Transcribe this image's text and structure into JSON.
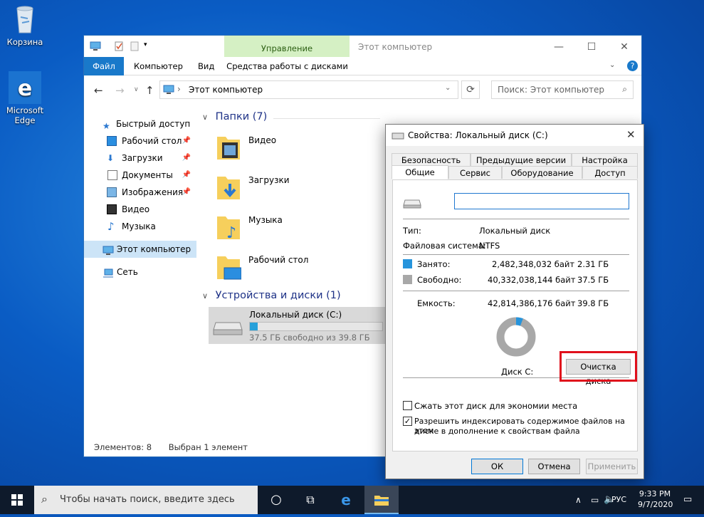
{
  "desktop": {
    "recycle_bin": "Корзина",
    "edge_line1": "Microsoft",
    "edge_line2": "Edge"
  },
  "explorer": {
    "context_tab": "Управление",
    "window_title": "Этот компьютер",
    "tabs": [
      "Файл",
      "Компьютер",
      "Вид",
      "Средства работы с дисками"
    ],
    "address": "Этот компьютер",
    "search_placeholder": "Поиск: Этот компьютер",
    "nav": {
      "quick_access": "Быстрый доступ",
      "desktop": "Рабочий стол",
      "downloads": "Загрузки",
      "documents": "Документы",
      "pictures": "Изображения",
      "videos": "Видео",
      "music": "Музыка",
      "this_pc": "Этот компьютер",
      "network": "Сеть"
    },
    "folders_header": "Папки (7)",
    "folders": [
      "Видео",
      "Загрузки",
      "Музыка",
      "Рабочий стол"
    ],
    "devices_header": "Устройства и диски (1)",
    "drive": {
      "name": "Локальный диск (C:)",
      "free_text": "37.5 ГБ свободно из 39.8 ГБ",
      "used_fraction": 0.058
    },
    "status": {
      "items": "Элементов: 8",
      "selected": "Выбран 1 элемент"
    }
  },
  "dialog": {
    "title": "Свойства: Локальный диск (C:)",
    "tabs_row1": [
      "Безопасность",
      "Предыдущие версии",
      "Настройка"
    ],
    "tabs_row2": [
      "Общие",
      "Сервис",
      "Оборудование",
      "Доступ"
    ],
    "type_label": "Тип:",
    "type_value": "Локальный диск",
    "fs_label": "Файловая система:",
    "fs_value": "NTFS",
    "used_label": "Занято:",
    "used_bytes": "2,482,348,032 байт",
    "used_gb": "2.31 ГБ",
    "free_label": "Свободно:",
    "free_bytes": "40,332,038,144 байт",
    "free_gb": "37.5 ГБ",
    "capacity_label": "Емкость:",
    "capacity_bytes": "42,814,386,176 байт",
    "capacity_gb": "39.8 ГБ",
    "disk_label": "Диск C:",
    "cleanup_button": "Очистка диска",
    "compress_label": "Сжать этот диск для экономии места",
    "index_label_line1": "Разрешить индексировать содержимое файлов на этом",
    "index_label_line2": "диске в дополнение к свойствам файла",
    "ok": "ОК",
    "cancel": "Отмена",
    "apply": "Применить",
    "colors": {
      "used": "#2694dc",
      "free": "#a8a8a8",
      "highlight": "#e0101c"
    }
  },
  "taskbar": {
    "search_placeholder": "Чтобы начать поиск, введите здесь",
    "lang": "РУС",
    "time": "9:33 PM",
    "date": "9/7/2020"
  }
}
